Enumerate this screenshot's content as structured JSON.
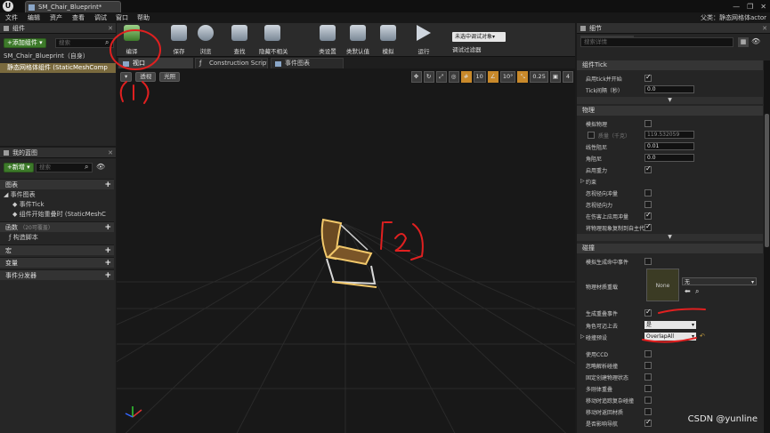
{
  "window": {
    "tab_title": "SM_Chair_Blueprint*",
    "controls": [
      "—",
      "❐",
      "✕"
    ]
  },
  "menu": {
    "items": [
      "文件",
      "编辑",
      "资产",
      "查看",
      "调试",
      "窗口",
      "帮助"
    ],
    "actor_label": "父类：静态网格体actor"
  },
  "components": {
    "title": "组件",
    "add_button": "+添加组件 ▾",
    "search_placeholder": "搜索",
    "root": "SM_Chair_Blueprint（自身）",
    "selected": "静态网格体组件 (StaticMeshComp"
  },
  "toolbar": {
    "items": [
      "编译",
      "保存",
      "浏览",
      "查找",
      "隐藏不相关",
      "类设置",
      "类默认值",
      "模拟",
      "运行"
    ],
    "debug_select": "未选中调试对象▾",
    "debug_label": "调试过滤器"
  },
  "editor_tabs": {
    "viewport": "视口",
    "construction": "Construction Script",
    "event_graph": "事件图表"
  },
  "viewport": {
    "view_mode": "透视",
    "lighting": "光照",
    "grid_snap": "10",
    "rot_snap": "10°",
    "scale_snap": "0.25",
    "cam_speed": "4"
  },
  "my_blueprint": {
    "title": "我的蓝图",
    "new_button": "+新增 ▾",
    "search_placeholder": "搜索",
    "graphs_label": "图表",
    "event_graph": "事件图表",
    "event_tick": "事件Tick",
    "overlap_event": "组件开始重叠时 (StaticMeshC",
    "functions_label": "函数",
    "functions_hint": "（20可覆盖）",
    "construct_script": "构造脚本",
    "macros_label": "宏",
    "variables_label": "变量",
    "dispatchers_label": "事件分发器"
  },
  "details": {
    "title": "细节",
    "search_placeholder": "搜索详情",
    "sec_tick": "组件Tick",
    "tick_start": "启用tick并开始",
    "tick_interval": "Tick间隔（秒）",
    "tick_interval_value": "0.0",
    "sec_physics": "物理",
    "simulate_physics": "模拟物理",
    "mass": "质量（千克）",
    "mass_value": "119.532059",
    "linear_damping": "线性阻尼",
    "linear_damping_value": "0.01",
    "angular_damping": "角阻尼",
    "angular_damping_value": "0.0",
    "enable_gravity": "启用重力",
    "constraints": "约束",
    "ignore_radial_impulse": "忽视径向冲量",
    "ignore_radial_force": "忽视径向力",
    "apply_impulse_on_damage": "在伤害上应用冲量",
    "replicate_physics": "将物理现象复制到自主代",
    "sec_collision": "碰撞",
    "sim_hit_events": "模拟生成命中事件",
    "phys_material_override": "物理材质重载",
    "phys_material_thumb": "None",
    "phys_material_value": "无",
    "generate_overlap": "生成重叠事件",
    "can_step_up": "角色可迈上去",
    "can_step_up_value": "是",
    "collision_presets": "碰撞预设",
    "collision_presets_value": "OverlapAll",
    "use_ccd": "使用CCD",
    "ignore_radial_hit": "忽略解析碰撞",
    "always_create_physics_state": "固定创建物理状态",
    "multi_body_overlap": "多刚体重叠",
    "check_async_scene": "移动时追踪复杂碰撞",
    "return_material": "移动时返回材质",
    "affect_navigation": "是否影响导航"
  },
  "watermark": "CSDN @yunline"
}
